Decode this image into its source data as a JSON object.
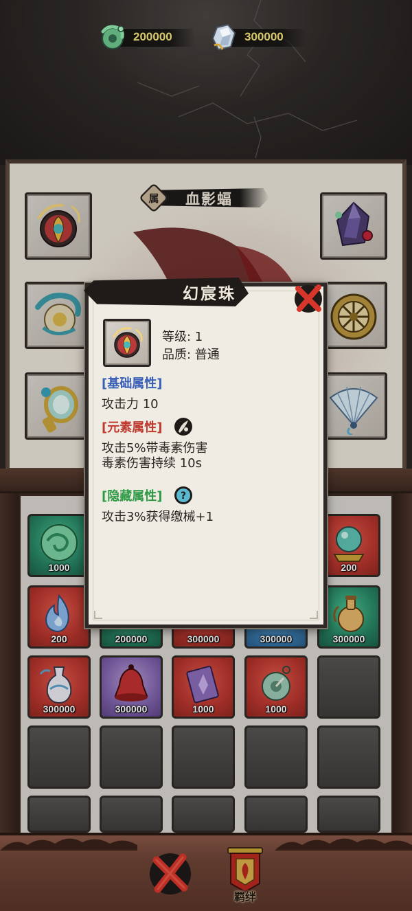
{
  "currencies": [
    {
      "icon": "jade-dragon-coin-icon",
      "value": "200000"
    },
    {
      "icon": "crystal-gem-icon",
      "value": "300000"
    }
  ],
  "character": {
    "badge": "属",
    "name": "血影蝠"
  },
  "equipment_slots": [
    {
      "icon": "illusion-orb-icon"
    },
    {
      "icon": "dark-crystal-icon"
    },
    {
      "icon": "dragon-ornament-icon"
    },
    {
      "icon": "bronze-wheel-icon"
    },
    {
      "icon": "golden-mirror-icon"
    },
    {
      "icon": "folding-fan-icon"
    }
  ],
  "inventory": [
    {
      "icon": "green-orb-icon",
      "qty": "1000",
      "color": "green"
    },
    {
      "icon": "item-icon",
      "qty": "",
      "color": "hidden"
    },
    {
      "icon": "item-icon",
      "qty": "",
      "color": "hidden"
    },
    {
      "icon": "item-icon",
      "qty": "",
      "color": "hidden"
    },
    {
      "icon": "crystal-ball-icon",
      "qty": "200",
      "color": "red"
    },
    {
      "icon": "blue-flame-icon",
      "qty": "200",
      "color": "red"
    },
    {
      "icon": "item-icon",
      "qty": "200000",
      "color": "green"
    },
    {
      "icon": "item-icon",
      "qty": "300000",
      "color": "red"
    },
    {
      "icon": "item-icon",
      "qty": "300000",
      "color": "blue"
    },
    {
      "icon": "gourd-bottle-icon",
      "qty": "300000",
      "color": "green"
    },
    {
      "icon": "vase-icon",
      "qty": "300000",
      "color": "red"
    },
    {
      "icon": "red-bell-icon",
      "qty": "300000",
      "color": "purple"
    },
    {
      "icon": "purple-scroll-icon",
      "qty": "1000",
      "color": "red"
    },
    {
      "icon": "jade-pendant-icon",
      "qty": "1000",
      "color": "red"
    },
    {
      "icon": "empty-slot",
      "qty": "",
      "color": "empty"
    }
  ],
  "popup": {
    "title": "幻宸珠",
    "level": "等级: 1",
    "quality": "品质: 普通",
    "base_header": "[基础属性]",
    "base_line": "攻击力  10",
    "element_header": "[元素属性]",
    "element_line1": "攻击5%带毒素伤害",
    "element_line2": "毒素伤害持续 10s",
    "hidden_header": "[隐藏属性]",
    "hidden_line": "攻击3%获得缴械+1"
  },
  "bottom_bar": {
    "bond_label": "羁绊"
  },
  "colors": {
    "currency_text": "#d7c96a",
    "base_attr": "#3a5fb8",
    "element_attr": "#c0392f",
    "hidden_attr": "#2f9a45",
    "close_red": "#d8362b"
  }
}
